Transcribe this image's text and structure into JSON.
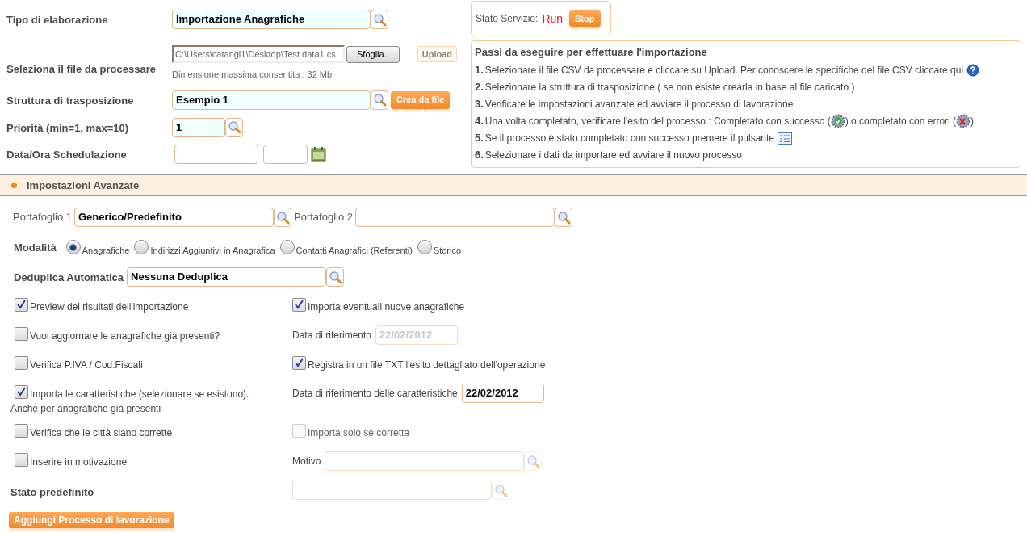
{
  "tipo": {
    "label": "Tipo di elaborazione",
    "value": "Importazione Anagrafiche"
  },
  "file": {
    "label": "Seleziona il file da processare",
    "value": "C:\\Users\\catangi1\\Desktop\\Test data1.cs",
    "browse": "Sfoglia..",
    "upload": "Upload",
    "hint": "Dimensione massima consentita : 32 Mb"
  },
  "struttura": {
    "label": "Struttura di trasposizione",
    "value": "Esempio 1",
    "button": "Crea da file"
  },
  "priorita": {
    "label": "Priorità (min=1, max=10)",
    "value": "1"
  },
  "schedulazione": {
    "label": "Data/Ora Schedulazione"
  },
  "service": {
    "label": "Stato Servizio:",
    "status": "Run",
    "button": "Stop"
  },
  "steps": {
    "title": "Passi da eseguire per effettuare l'importazione",
    "items": [
      {
        "number": "1.",
        "parts": [
          {
            "kind": "text",
            "text": "Selezionare il file CSV da processare e cliccare su Upload. Per conoscere le specifiche del file CSV cliccare qui"
          },
          {
            "kind": "help"
          }
        ]
      },
      {
        "number": "2.",
        "parts": [
          {
            "kind": "text",
            "text": "Selezionare la struttura di trasposizione ( se non esiste crearla in base al file caricato )"
          }
        ]
      },
      {
        "number": "3.",
        "parts": [
          {
            "kind": "text",
            "text": "Verificare le impostazioni avanzate ed avviare il processo di lavorazione"
          }
        ]
      },
      {
        "number": "4.",
        "parts": [
          {
            "kind": "text",
            "text": "Una volta completato, verificare l'esito del processo : Completato con successo ("
          },
          {
            "kind": "success"
          },
          {
            "kind": "text",
            "text": ") o completato con errori ("
          },
          {
            "kind": "error"
          },
          {
            "kind": "text",
            "text": ")"
          }
        ]
      },
      {
        "number": "5.",
        "parts": [
          {
            "kind": "text",
            "text": "Se il processo è stato completato con successo premere il pulsante"
          },
          {
            "kind": "list"
          }
        ]
      },
      {
        "number": "6.",
        "parts": [
          {
            "kind": "text",
            "text": "Selezionare i dati da importare ed avviare il nuovo processo"
          }
        ]
      }
    ]
  },
  "section_title": "Impostazioni Avanzate",
  "portfolios": [
    {
      "label": "Portafoglio 1",
      "value": "Generico/Predefinito"
    },
    {
      "label": "Portafoglio 2"
    }
  ],
  "modalita": {
    "label": "Modalità",
    "options": [
      {
        "label": "Anagrafiche",
        "selected": true
      },
      {
        "label": "Indirizzi Aggiuntivi in Anagrafica",
        "selected": false
      },
      {
        "label": "Contatti Anagrafici (Referenti)",
        "selected": false
      },
      {
        "label": "Storico",
        "selected": false
      }
    ]
  },
  "deduplica": {
    "label": "Deduplica Automatica",
    "value": "Nessuna Deduplica"
  },
  "rows": [
    {
      "left": {
        "kind": "checkbox",
        "label": "Preview dei risultati dell'importazione",
        "checked": true
      },
      "right": {
        "kind": "checkbox",
        "label": "Importa eventuali nuove anagrafiche",
        "checked": true,
        "disabled": false
      }
    },
    {
      "left": {
        "kind": "checkbox",
        "label": "Vuoi aggiornare le anagrafiche già presenti?",
        "checked": false
      },
      "right": {
        "kind": "date",
        "label": "Data di riferimento",
        "value": "22/02/2012",
        "disabled": true
      }
    },
    {
      "left": {
        "kind": "checkbox",
        "label": "Verifica P.IVA / Cod.Fiscali",
        "checked": false
      },
      "right": {
        "kind": "checkbox",
        "label": "Registra in un file TXT l'esito dettagliato dell'operazione",
        "checked": true,
        "disabled": false
      }
    },
    {
      "left": {
        "kind": "checkbox",
        "label": "Importa le caratteristiche (selezionare se esistono).",
        "note": "Anche per anagrafiche già presenti",
        "checked": true
      },
      "right": {
        "kind": "date",
        "label": "Data di riferimento delle caratteristiche",
        "value": "22/02/2012",
        "disabled": false
      }
    },
    {
      "left": {
        "kind": "checkbox",
        "label": "Verifica che le città siano corrette",
        "checked": false
      },
      "right": {
        "kind": "checkbox",
        "label": "Importa solo se corretta",
        "checked": false,
        "disabled": true
      }
    },
    {
      "left": {
        "kind": "checkbox",
        "label": "Inserire in motivazione",
        "checked": false
      },
      "right": {
        "kind": "lookup",
        "label": "Motivo",
        "disabled": true
      }
    },
    {
      "left": {
        "kind": "heading",
        "label": "Stato predefinito"
      },
      "right": {
        "kind": "lookup",
        "disabled": true
      }
    }
  ],
  "submit": "Aggiungi Processo di lavorazione"
}
